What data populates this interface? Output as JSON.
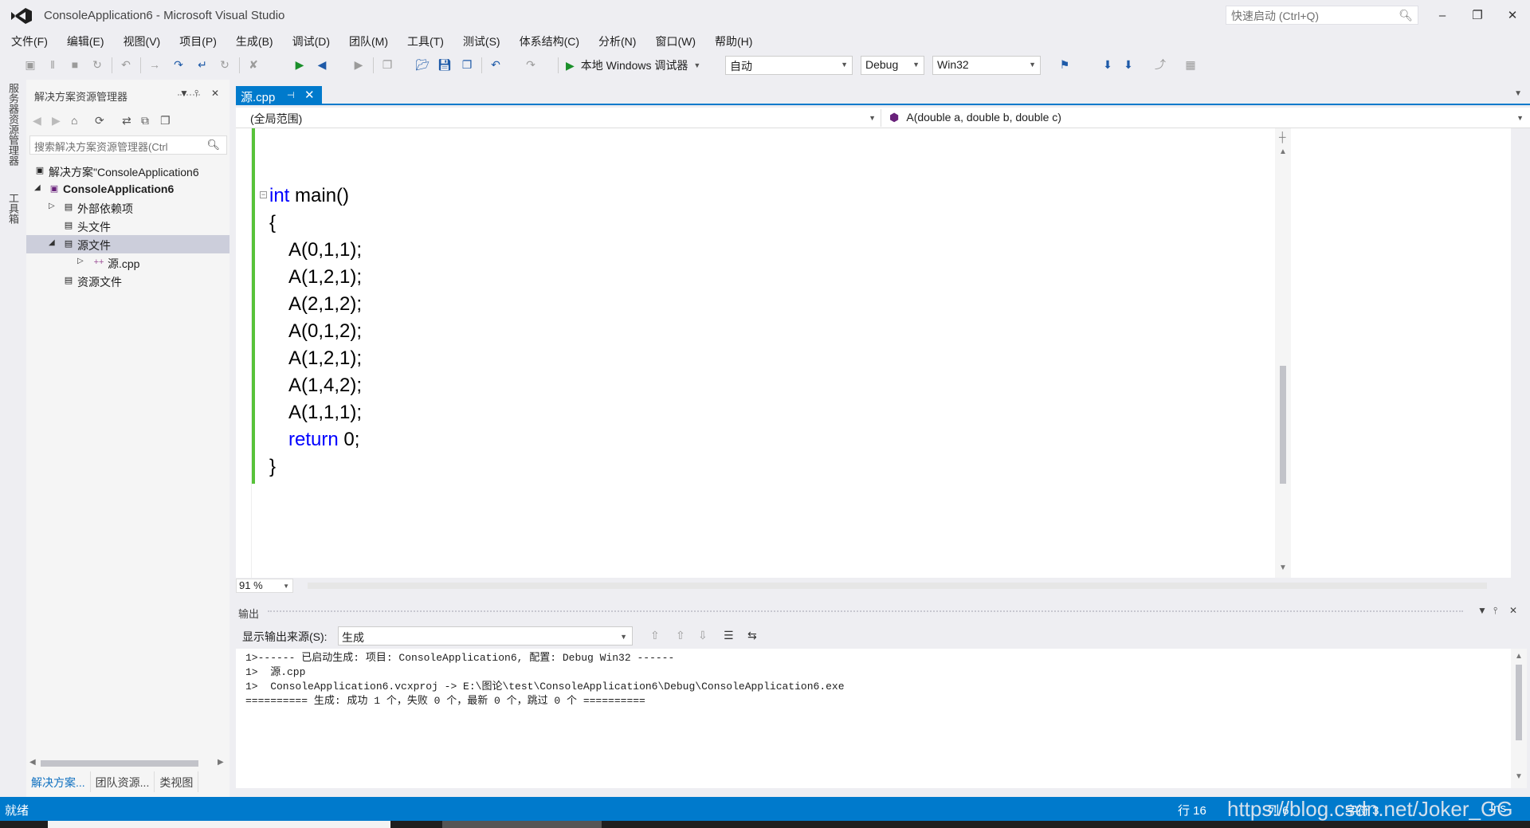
{
  "window": {
    "title": "ConsoleApplication6 - Microsoft Visual Studio",
    "quick_launch_placeholder": "快速启动 (Ctrl+Q)",
    "accent_color": "#007acc"
  },
  "menu": [
    "文件(F)",
    "编辑(E)",
    "视图(V)",
    "项目(P)",
    "生成(B)",
    "调试(D)",
    "团队(M)",
    "工具(T)",
    "测试(S)",
    "体系结构(C)",
    "分析(N)",
    "窗口(W)",
    "帮助(H)"
  ],
  "toolbar": {
    "run_label": "本地 Windows 调试器",
    "run_mode": "自动",
    "configuration": "Debug",
    "platform": "Win32"
  },
  "left_tabs": [
    "服务器资源管理器",
    "工具箱"
  ],
  "solution_explorer": {
    "title": "解决方案资源管理器",
    "search_placeholder": "搜索解决方案资源管理器(Ctrl",
    "tree": [
      {
        "label": "解决方案\"ConsoleApplication6",
        "level": 0,
        "icon": "solution-icon"
      },
      {
        "label": "ConsoleApplication6",
        "level": 1,
        "icon": "project-icon",
        "bold": true,
        "expanded": true
      },
      {
        "label": "外部依赖项",
        "level": 2,
        "icon": "dependencies-icon",
        "expanded": false
      },
      {
        "label": "头文件",
        "level": 2,
        "icon": "folder-icon"
      },
      {
        "label": "源文件",
        "level": 2,
        "icon": "folder-icon",
        "expanded": true,
        "selected": true
      },
      {
        "label": "源.cpp",
        "level": 3,
        "icon": "cpp-file-icon",
        "expanded": false
      },
      {
        "label": "资源文件",
        "level": 2,
        "icon": "folder-icon"
      }
    ],
    "bottom_tabs": [
      "解决方案...",
      "团队资源...",
      "类视图"
    ]
  },
  "editor": {
    "tab_label": "源.cpp",
    "scope": "(全局范围)",
    "member": "A(double a, double b, double c)",
    "zoom": "91 %",
    "code_lines": [
      {
        "tokens": [
          {
            "t": "int",
            "kw": true
          },
          {
            "t": " main()",
            "kw": false
          }
        ],
        "indent": 0
      },
      {
        "tokens": [
          {
            "t": "{",
            "kw": false
          }
        ],
        "indent": 0
      },
      {
        "tokens": [
          {
            "t": "A(0,1,1);",
            "kw": false
          }
        ],
        "indent": 1
      },
      {
        "tokens": [
          {
            "t": "A(1,2,1);",
            "kw": false
          }
        ],
        "indent": 1
      },
      {
        "tokens": [
          {
            "t": "A(2,1,2);",
            "kw": false
          }
        ],
        "indent": 1
      },
      {
        "tokens": [
          {
            "t": "A(0,1,2);",
            "kw": false
          }
        ],
        "indent": 1
      },
      {
        "tokens": [
          {
            "t": "A(1,2,1);",
            "kw": false
          }
        ],
        "indent": 1
      },
      {
        "tokens": [
          {
            "t": "A(1,4,2);",
            "kw": false
          }
        ],
        "indent": 1
      },
      {
        "tokens": [
          {
            "t": "A(1,1,1);",
            "kw": false
          }
        ],
        "indent": 1
      },
      {
        "tokens": [
          {
            "t": "return",
            "kw": true
          },
          {
            "t": " 0;",
            "kw": false
          }
        ],
        "indent": 1
      },
      {
        "tokens": [
          {
            "t": "}",
            "kw": false
          }
        ],
        "indent": 0
      }
    ]
  },
  "output": {
    "title": "输出",
    "source_label": "显示输出来源(S):",
    "source_value": "生成",
    "lines": [
      "1>------ 已启动生成: 项目: ConsoleApplication6, 配置: Debug Win32 ------",
      "1>  源.cpp",
      "1>  ConsoleApplication6.vcxproj -> E:\\图论\\test\\ConsoleApplication6\\Debug\\ConsoleApplication6.exe",
      "========== 生成: 成功 1 个，失败 0 个，最新 0 个，跳过 0 个 =========="
    ]
  },
  "status": {
    "left": "就绪",
    "line": "行 16",
    "col": "列 6",
    "ch": "字符 3",
    "ins": "Ins",
    "watermark": "https://blog.csdn.net/Joker_GG"
  }
}
